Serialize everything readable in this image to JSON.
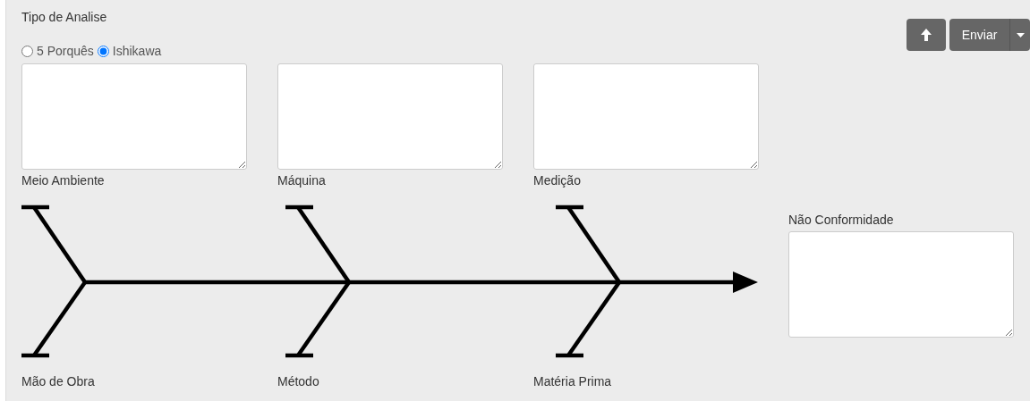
{
  "analysis_type": {
    "label": "Tipo de Analise",
    "options": [
      {
        "label": "5 Porquês",
        "selected": false
      },
      {
        "label": "Ishikawa",
        "selected": true
      }
    ]
  },
  "send_button": {
    "label": "Enviar"
  },
  "top_causes": [
    "Meio Ambiente",
    "Máquina",
    "Medição"
  ],
  "bottom_causes": [
    "Mão de Obra",
    "Método",
    "Matéria Prima"
  ],
  "effect": {
    "label": "Não Conformidade"
  }
}
